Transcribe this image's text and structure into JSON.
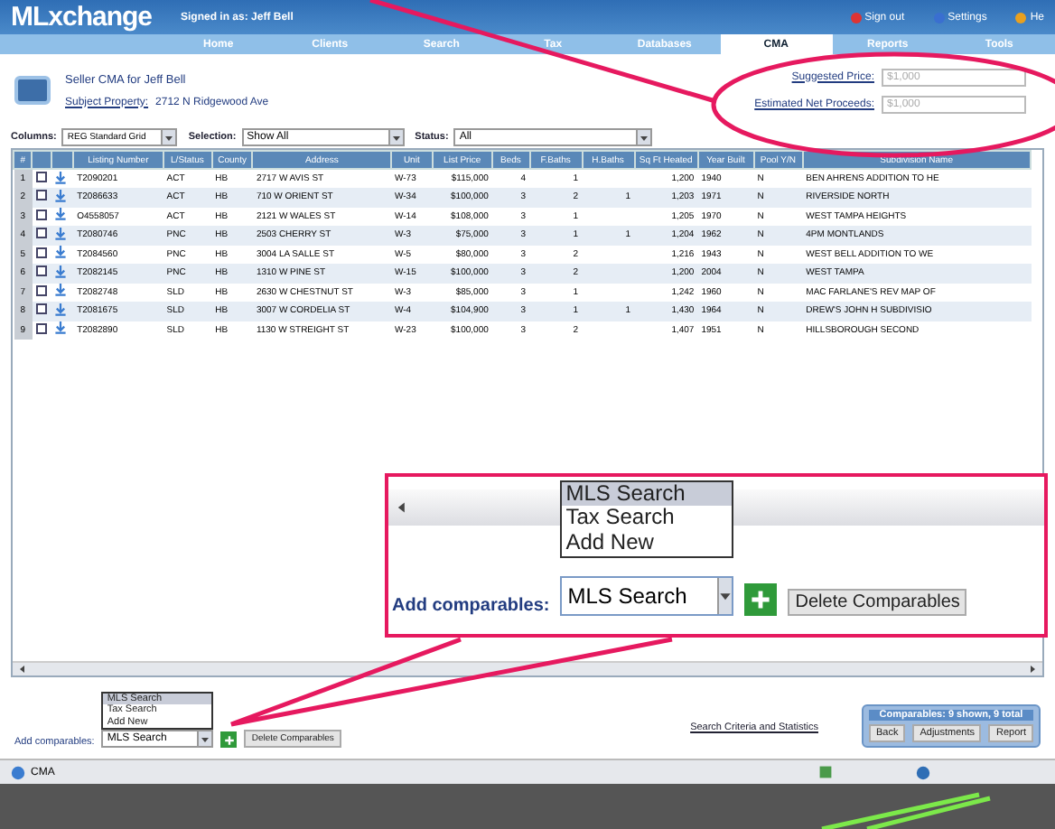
{
  "header": {
    "logo": "MLxchange",
    "signed_in": "Signed in as: Jeff Bell",
    "links": [
      "Sign out",
      "Settings",
      "He"
    ]
  },
  "tabs": [
    {
      "label": "Home",
      "selected": false
    },
    {
      "label": "Clients",
      "selected": false
    },
    {
      "label": "Search",
      "selected": false
    },
    {
      "label": "Tax",
      "selected": false
    },
    {
      "label": "Databases",
      "selected": false
    },
    {
      "label": "CMA",
      "selected": true
    },
    {
      "label": "Reports",
      "selected": false
    },
    {
      "label": "Tools",
      "selected": false
    }
  ],
  "cma": {
    "title": "Seller CMA for Jeff Bell",
    "subject_label": "Subject Property:",
    "subject_value": "2712 N Ridgewood Ave",
    "fields": [
      {
        "label": "Suggested Price:",
        "placeholder": "$1,000"
      },
      {
        "label": "Estimated Net Proceeds:",
        "placeholder": "$1,000"
      }
    ]
  },
  "filters": [
    {
      "label": "Columns:",
      "value": "REG Standard Grid"
    },
    {
      "label": "Selection:",
      "value": "Show All"
    },
    {
      "label": "Status:",
      "value": "All"
    }
  ],
  "table": {
    "columns": [
      "#",
      "",
      "",
      "Listing Number",
      "L/Status",
      "County",
      "Address",
      "Unit",
      "List Price",
      "Beds",
      "F.Baths",
      "H.Baths",
      "Sq Ft Heated",
      "Year Built",
      "Pool Y/N",
      "Subdivision Name"
    ],
    "rows": [
      {
        "checked": false,
        "cells": [
          "1",
          "",
          "",
          "T2090201",
          "ACT",
          "HB",
          "2717 W AVIS ST",
          "W-73",
          "$115,000",
          "4",
          "1",
          "",
          "1,200",
          "1940",
          "N",
          "BEN AHRENS ADDITION TO HE"
        ]
      },
      {
        "checked": false,
        "cells": [
          "2",
          "",
          "",
          "T2086633",
          "ACT",
          "HB",
          "710 W ORIENT ST",
          "W-34",
          "$100,000",
          "3",
          "2",
          "1",
          "1,203",
          "1971",
          "N",
          "RIVERSIDE NORTH"
        ]
      },
      {
        "checked": false,
        "cells": [
          "3",
          "",
          "",
          "O4558057",
          "ACT",
          "HB",
          "2121 W WALES ST",
          "W-14",
          "$108,000",
          "3",
          "1",
          "",
          "1,205",
          "1970",
          "N",
          "WEST TAMPA HEIGHTS"
        ]
      },
      {
        "checked": false,
        "cells": [
          "4",
          "",
          "",
          "T2080746",
          "PNC",
          "HB",
          "2503 CHERRY ST",
          "W-3",
          "$75,000",
          "3",
          "1",
          "1",
          "1,204",
          "1962",
          "N",
          "4PM MONTLANDS"
        ]
      },
      {
        "checked": false,
        "cells": [
          "5",
          "",
          "",
          "T2084560",
          "PNC",
          "HB",
          "3004 LA SALLE ST",
          "W-5",
          "$80,000",
          "3",
          "2",
          "",
          "1,216",
          "1943",
          "N",
          "WEST BELL ADDITION TO WE"
        ]
      },
      {
        "checked": false,
        "cells": [
          "6",
          "",
          "",
          "T2082145",
          "PNC",
          "HB",
          "1310 W PINE ST",
          "W-15",
          "$100,000",
          "3",
          "2",
          "",
          "1,200",
          "2004",
          "N",
          "WEST TAMPA"
        ]
      },
      {
        "checked": false,
        "cells": [
          "7",
          "",
          "",
          "T2082748",
          "SLD",
          "HB",
          "2630 W CHESTNUT ST",
          "W-3",
          "$85,000",
          "3",
          "1",
          "",
          "1,242",
          "1960",
          "N",
          "MAC FARLANE'S REV MAP OF"
        ]
      },
      {
        "checked": false,
        "cells": [
          "8",
          "",
          "",
          "T2081675",
          "SLD",
          "HB",
          "3007 W CORDELIA ST",
          "W-4",
          "$104,900",
          "3",
          "1",
          "1",
          "1,430",
          "1964",
          "N",
          "DREW'S JOHN H SUBDIVISIO"
        ]
      },
      {
        "checked": false,
        "cells": [
          "9",
          "",
          "",
          "T2082890",
          "SLD",
          "HB",
          "1130 W STREIGHT ST",
          "W-23",
          "$100,000",
          "3",
          "2",
          "",
          "1,407",
          "1951",
          "N",
          "HILLSBOROUGH SECOND"
        ]
      }
    ]
  },
  "add_comparables": {
    "label": "Add comparables:",
    "value": "MLS Search",
    "options": [
      {
        "label": "MLS Search",
        "selected": true
      },
      {
        "label": "Tax Search",
        "selected": false
      },
      {
        "label": "Add New",
        "selected": false
      }
    ],
    "delete": "Delete Comparables"
  },
  "inset": {
    "label": "Add comparables:",
    "value": "MLS Search",
    "options": [
      {
        "label": "MLS Search",
        "selected": true
      },
      {
        "label": "Tax Search",
        "selected": false
      },
      {
        "label": "Add New",
        "selected": false
      }
    ],
    "delete": "Delete Comparables"
  },
  "search_link": "Search Criteria and Statistics",
  "summary": {
    "title": "Comparables: 9 shown, 9 total",
    "buttons": [
      "Back",
      "Adjustments",
      "Report"
    ]
  },
  "status_bar": {
    "text": "CMA"
  }
}
